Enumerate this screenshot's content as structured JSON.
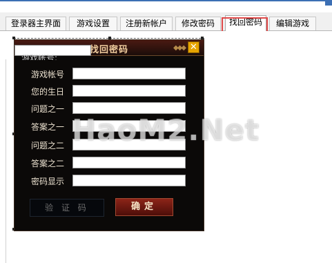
{
  "tabs": [
    {
      "label": "登录器主界面"
    },
    {
      "label": "游戏设置"
    },
    {
      "label": "注册新帐户"
    },
    {
      "label": "修改密码"
    },
    {
      "label": "找回密码"
    },
    {
      "label": "编辑游戏"
    }
  ],
  "dialog": {
    "title": "找回密码",
    "close_symbol": "✕",
    "clipped_text": "游戏帐号:",
    "fields": [
      {
        "label": "游戏帐号",
        "value": ""
      },
      {
        "label": "您的生日",
        "value": ""
      },
      {
        "label": "问题之一",
        "value": ""
      },
      {
        "label": "答案之一",
        "value": ""
      },
      {
        "label": "问题之二",
        "value": ""
      },
      {
        "label": "答案之二",
        "value": ""
      },
      {
        "label": "密码显示",
        "value": ""
      }
    ],
    "captcha_label": "验 证 码",
    "confirm_label": "确定"
  },
  "watermark": "HaoM2.Net",
  "colors": {
    "dialog_bg": "#0b0908",
    "title_text": "#f2cfa0",
    "close_button": "#e7a400",
    "confirm_button": "#8c2418",
    "highlight_box": "#e04848"
  }
}
